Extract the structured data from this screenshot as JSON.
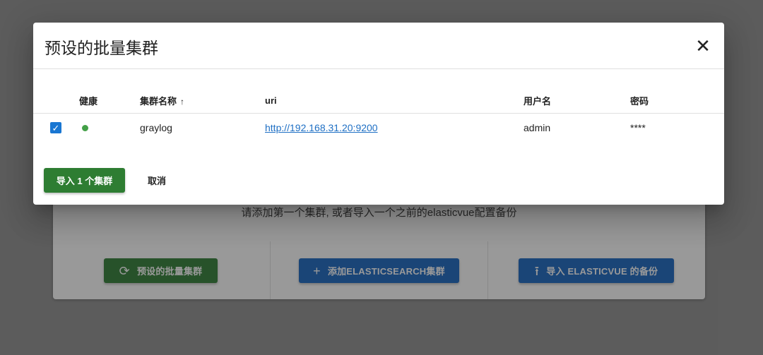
{
  "background": {
    "message": "请添加第一个集群, 或者导入一个之前的elasticvue配置备份",
    "buttons": [
      {
        "label": "预设的批量集群",
        "icon": "sync-icon",
        "color": "#2e7d32"
      },
      {
        "label": "添加ELASTICSEARCH集群",
        "icon": "plus-icon",
        "color": "#1565c0"
      },
      {
        "label": "导入 ELASTICVUE 的备份",
        "icon": "upload-icon",
        "color": "#1565c0"
      }
    ]
  },
  "dialog": {
    "title": "预设的批量集群",
    "close_icon": "close-icon",
    "table": {
      "headers": {
        "health": "健康",
        "name": "集群名称",
        "uri": "uri",
        "username": "用户名",
        "password": "密码"
      },
      "sort": {
        "column": "name",
        "direction": "ascending",
        "icon": "arrow-up-icon"
      },
      "rows": [
        {
          "checked": true,
          "health": "green",
          "name": "graylog",
          "uri": "http://192.168.31.20:9200",
          "username": "admin",
          "password": "****"
        }
      ]
    },
    "import_button": "导入 1 个集群",
    "cancel_button": "取消"
  },
  "colors": {
    "primary_green": "#2e7d32",
    "primary_blue": "#1565c0",
    "checkbox": "#1976d2",
    "health_green": "#43a047",
    "link": "#1e6fc4"
  }
}
